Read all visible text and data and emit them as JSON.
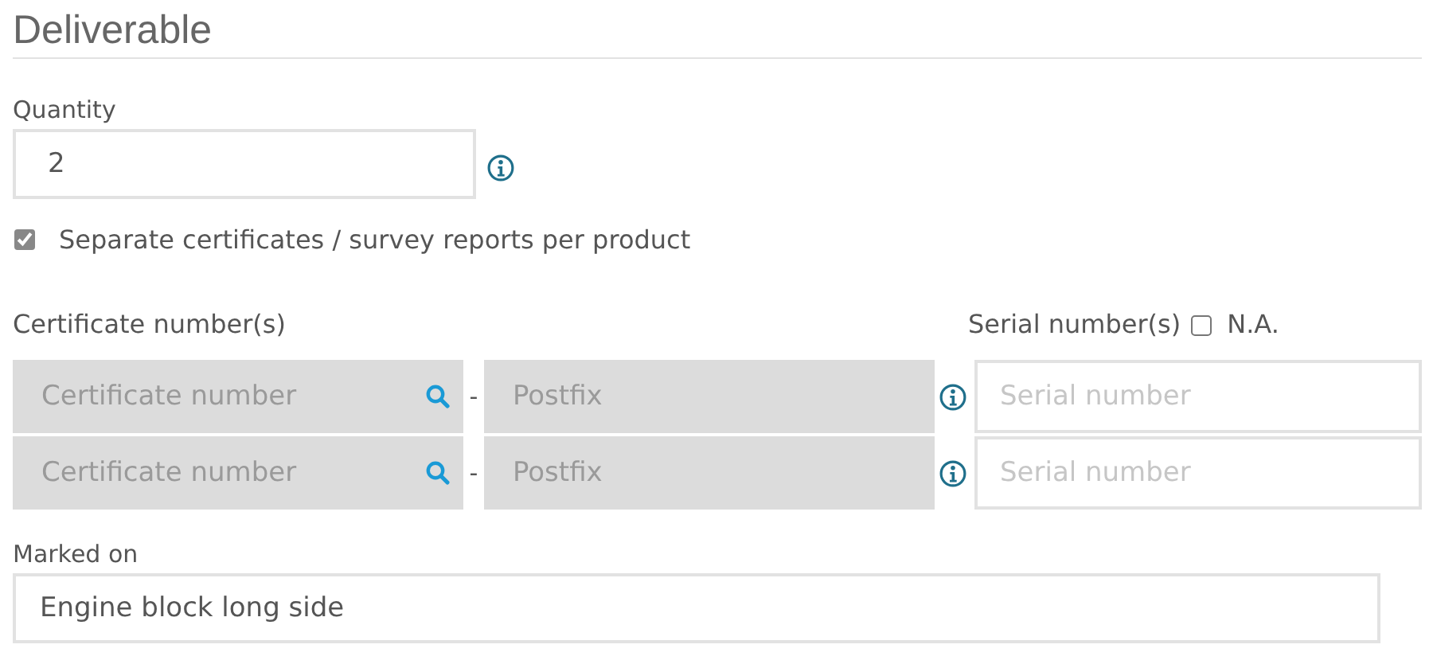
{
  "title": "Deliverable",
  "quantity": {
    "label": "Quantity",
    "value": "2"
  },
  "separate": {
    "label": "Separate certificates / survey reports per product",
    "checked": true
  },
  "certificates": {
    "label": "Certificate number(s)"
  },
  "serials": {
    "label": "Serial number(s)",
    "na_label": "N.A.",
    "na_checked": false
  },
  "rows": [
    {
      "certificate_placeholder": "Certificate number",
      "separator": "-",
      "postfix_placeholder": "Postfix",
      "serial_placeholder": "Serial number",
      "disabled": true
    },
    {
      "certificate_placeholder": "Certificate number",
      "separator": "-",
      "postfix_placeholder": "Postfix",
      "serial_placeholder": "Serial number",
      "disabled": true
    }
  ],
  "marked_on": {
    "label": "Marked on",
    "value": "Engine block long side"
  }
}
